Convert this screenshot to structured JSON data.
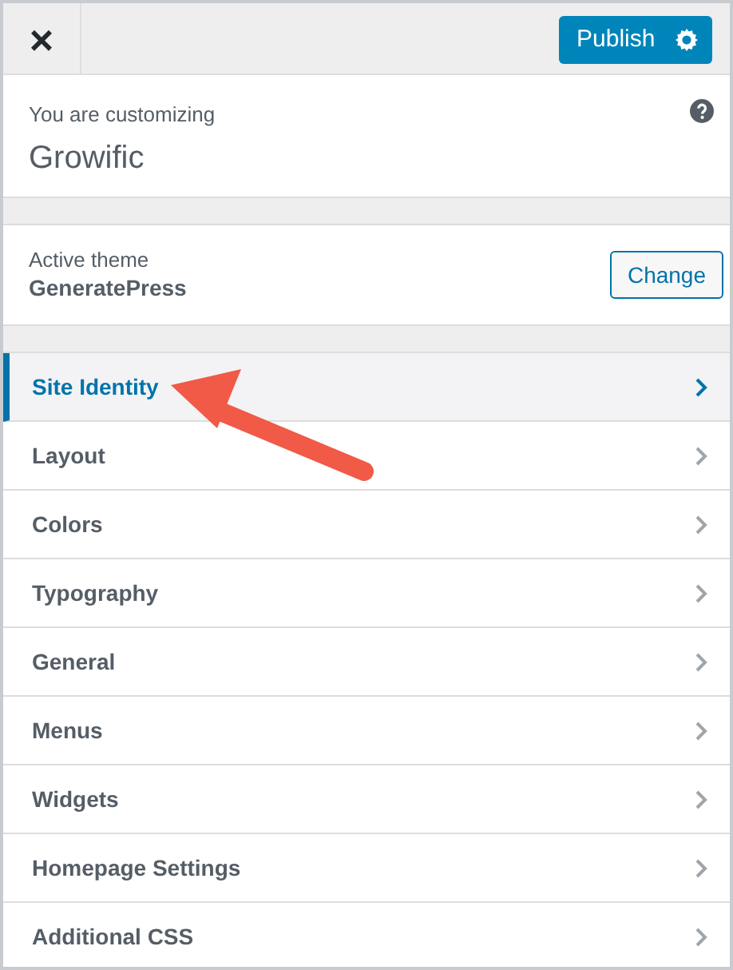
{
  "header": {
    "close": "×",
    "publish": "Publish"
  },
  "info": {
    "label": "You are customizing",
    "site": "Growific"
  },
  "theme": {
    "label": "Active theme",
    "name": "GeneratePress",
    "button": "Change"
  },
  "sections": [
    {
      "label": "Site Identity",
      "selected": true
    },
    {
      "label": "Layout",
      "selected": false
    },
    {
      "label": "Colors",
      "selected": false
    },
    {
      "label": "Typography",
      "selected": false
    },
    {
      "label": "General",
      "selected": false
    },
    {
      "label": "Menus",
      "selected": false
    },
    {
      "label": "Widgets",
      "selected": false
    },
    {
      "label": "Homepage Settings",
      "selected": false
    },
    {
      "label": "Additional CSS",
      "selected": false
    }
  ]
}
